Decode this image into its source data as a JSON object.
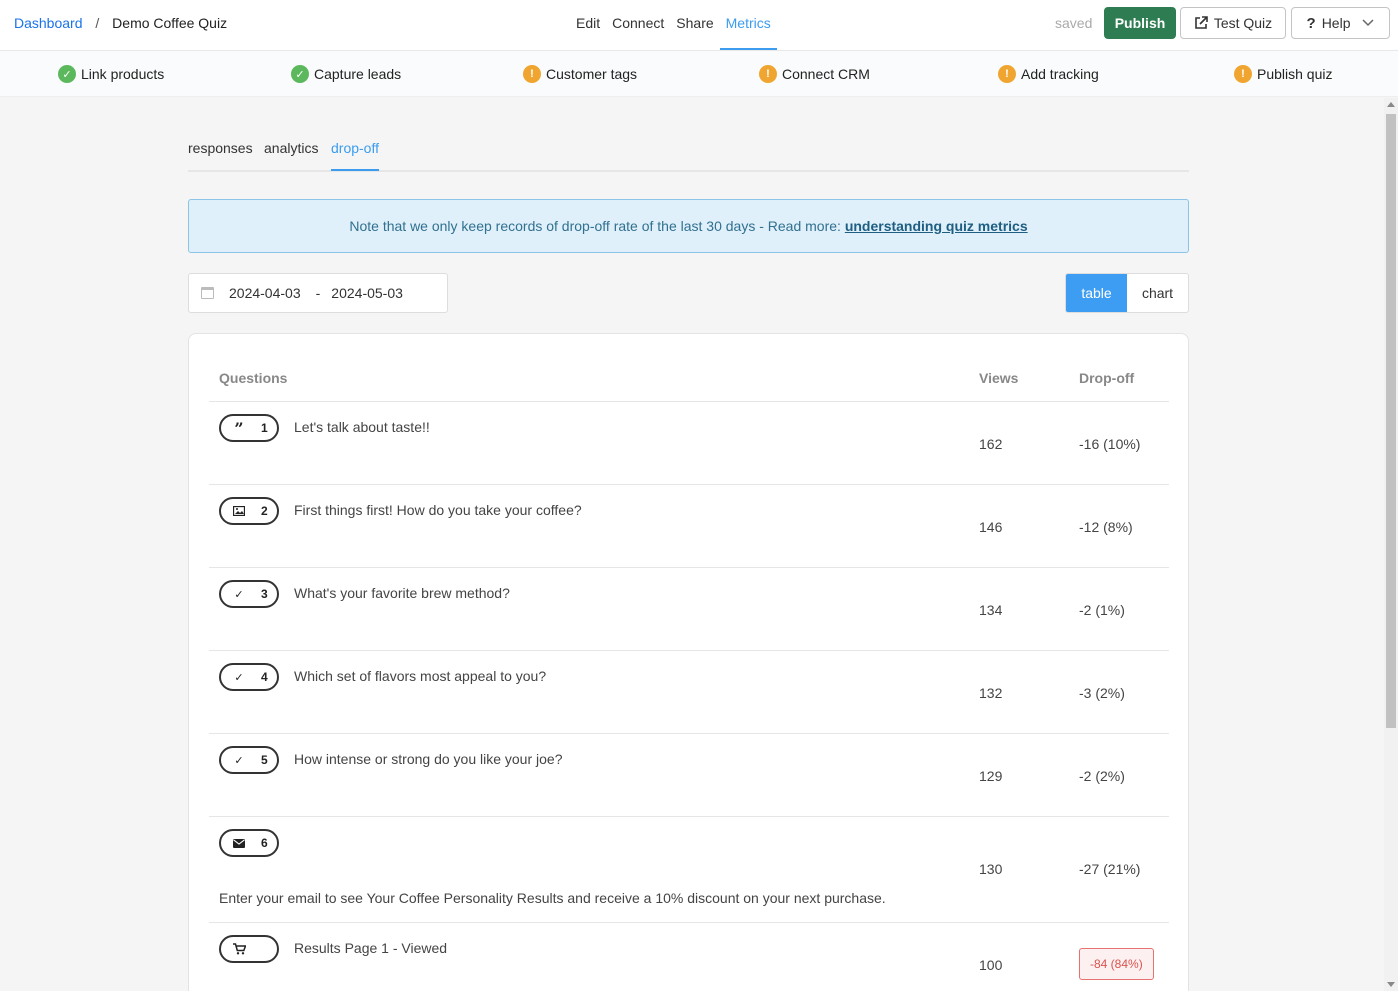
{
  "header": {
    "breadcrumb_root": "Dashboard",
    "breadcrumb_sep": "/",
    "breadcrumb_current": "Demo Coffee Quiz",
    "nav": [
      {
        "label": "Edit",
        "active": false
      },
      {
        "label": "Connect",
        "active": false
      },
      {
        "label": "Share",
        "active": false
      },
      {
        "label": "Metrics",
        "active": true
      }
    ],
    "saved_status": "saved",
    "publish_label": "Publish",
    "test_quiz_label": "Test Quiz",
    "help_label": "Help"
  },
  "checklist": [
    {
      "label": "Link products",
      "status": "done"
    },
    {
      "label": "Capture leads",
      "status": "done"
    },
    {
      "label": "Customer tags",
      "status": "warning"
    },
    {
      "label": "Connect CRM",
      "status": "warning"
    },
    {
      "label": "Add tracking",
      "status": "warning"
    },
    {
      "label": "Publish quiz",
      "status": "warning"
    }
  ],
  "tabs": [
    {
      "label": "responses",
      "active": false
    },
    {
      "label": "analytics",
      "active": false
    },
    {
      "label": "drop-off",
      "active": true
    }
  ],
  "notice": {
    "text": "Note that we only keep records of drop-off rate of the last 30 days - Read more: ",
    "link": "understanding quiz metrics"
  },
  "date_range": {
    "start": "2024-04-03",
    "separator": "-",
    "end": "2024-05-03"
  },
  "view_toggle": {
    "table": "table",
    "chart": "chart",
    "active": "table"
  },
  "table": {
    "headers": {
      "questions": "Questions",
      "views": "Views",
      "dropoff": "Drop-off"
    },
    "rows": [
      {
        "icon": "quote-icon",
        "num": "1",
        "text": "Let's talk about taste!!",
        "sub": "",
        "views": "162",
        "dropoff": "-16 (10%)",
        "alert": false
      },
      {
        "icon": "image-icon",
        "num": "2",
        "text": "First things first! How do you take your coffee?",
        "sub": "",
        "views": "146",
        "dropoff": "-12 (8%)",
        "alert": false
      },
      {
        "icon": "check-icon",
        "num": "3",
        "text": "What's your favorite brew method?",
        "sub": "",
        "views": "134",
        "dropoff": "-2 (1%)",
        "alert": false
      },
      {
        "icon": "check-icon",
        "num": "4",
        "text": "Which set of flavors most appeal to you?",
        "sub": "",
        "views": "132",
        "dropoff": "-3 (2%)",
        "alert": false
      },
      {
        "icon": "check-icon",
        "num": "5",
        "text": "How intense or strong do you like your joe?",
        "sub": "",
        "views": "129",
        "dropoff": "-2 (2%)",
        "alert": false
      },
      {
        "icon": "envelope-icon",
        "num": "6",
        "text": "",
        "sub": "Enter your email to see Your Coffee Personality Results and receive a 10% discount on your next purchase.",
        "views": "130",
        "dropoff": "-27 (21%)",
        "alert": false
      },
      {
        "icon": "cart-icon",
        "num": "",
        "text": "Results Page 1 - Viewed",
        "sub": "",
        "views": "100",
        "dropoff": "-84 (84%)",
        "alert": true
      }
    ]
  },
  "colors": {
    "accent": "#3b9cf0",
    "publish": "#2e7d52",
    "ok": "#5cb85c",
    "warn": "#f0a530",
    "alert": "#d9534f"
  }
}
